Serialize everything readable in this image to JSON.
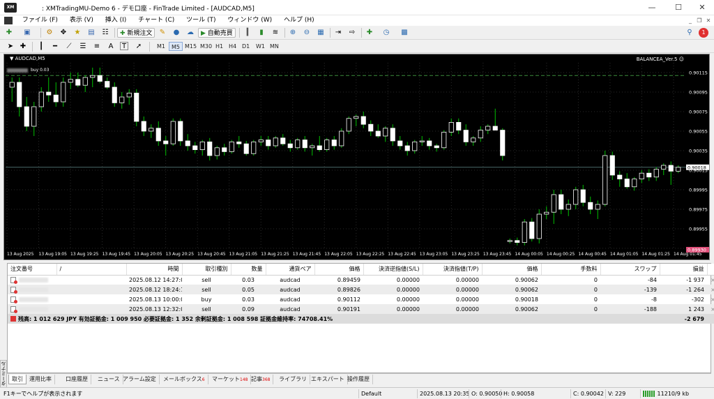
{
  "window": {
    "title": ": XMTradingMU-Demo 6 - デモ口座 - FinTrade Limited - [AUDCAD,M5]",
    "logo_text": "XM"
  },
  "menu": [
    "ファイル (F)",
    "表示 (V)",
    "挿入 (I)",
    "チャート (C)",
    "ツール (T)",
    "ウィンドウ (W)",
    "ヘルプ (H)"
  ],
  "toolbar": {
    "new_order_label": "新規注文",
    "autotrade_label": "自動売買",
    "notification_count": "1"
  },
  "tools": [
    "A",
    "T"
  ],
  "timeframes": [
    "M1",
    "M5",
    "M15",
    "M30",
    "H1",
    "H4",
    "D1",
    "W1",
    "MN"
  ],
  "active_timeframe": "M5",
  "chart": {
    "symbol_title": "AUDCAD,M5",
    "indicator": "BALANCEA_Ver.5",
    "order_line_label": "buy 0.03",
    "current_price": "0.90018",
    "bid_marker": "0.89930",
    "colors": {
      "background": "#000000",
      "bull_fill": "#000000",
      "bull_stroke": "#ffffff",
      "bear_fill": "#ffffff",
      "wick": "#00c000",
      "order_line": "#3c8c3c",
      "price_line": "#4a6a6a",
      "bid_marker": "#e0507a"
    }
  },
  "chart_data": {
    "type": "candlestick",
    "price_axis_labels": [
      "0.90115",
      "0.90095",
      "0.90075",
      "0.90055",
      "0.90035",
      "0.90015",
      "0.89995",
      "0.89975",
      "0.89955",
      "0.89935"
    ],
    "time_axis_labels": [
      "13 Aug 2025",
      "13 Aug 19:05",
      "13 Aug 19:25",
      "13 Aug 19:45",
      "13 Aug 20:05",
      "13 Aug 20:25",
      "13 Aug 20:45",
      "13 Aug 21:05",
      "13 Aug 21:25",
      "13 Aug 21:45",
      "13 Aug 22:05",
      "13 Aug 22:25",
      "13 Aug 22:45",
      "13 Aug 23:05",
      "13 Aug 23:25",
      "13 Aug 23:45",
      "14 Aug 00:05",
      "14 Aug 00:25",
      "14 Aug 00:45",
      "14 Aug 01:05",
      "14 Aug 01:25",
      "14 Aug 01:45"
    ],
    "ylim": [
      0.89935,
      0.90125
    ],
    "order_line_price": 0.90112,
    "current_price": 0.90018,
    "ohlc": [
      [
        0.901,
        0.9011,
        0.90085,
        0.90105
      ],
      [
        0.90105,
        0.9011,
        0.9007,
        0.9008
      ],
      [
        0.9008,
        0.9009,
        0.90055,
        0.9006
      ],
      [
        0.9006,
        0.90085,
        0.9005,
        0.9008
      ],
      [
        0.9008,
        0.901,
        0.90075,
        0.90095
      ],
      [
        0.90095,
        0.9011,
        0.90085,
        0.90092
      ],
      [
        0.90092,
        0.90105,
        0.9008,
        0.90085
      ],
      [
        0.90085,
        0.9011,
        0.9008,
        0.90105
      ],
      [
        0.90105,
        0.90115,
        0.90098,
        0.90108
      ],
      [
        0.90108,
        0.90115,
        0.901,
        0.90102
      ],
      [
        0.90102,
        0.90112,
        0.90095,
        0.9011
      ],
      [
        0.9011,
        0.9012,
        0.901,
        0.90112
      ],
      [
        0.90112,
        0.9012,
        0.90104,
        0.90106
      ],
      [
        0.90106,
        0.9011,
        0.90098,
        0.901
      ],
      [
        0.901,
        0.90105,
        0.9008,
        0.90084
      ],
      [
        0.90084,
        0.90095,
        0.90078,
        0.9009
      ],
      [
        0.9009,
        0.90098,
        0.90082,
        0.90094
      ],
      [
        0.90094,
        0.90098,
        0.9006,
        0.90065
      ],
      [
        0.90065,
        0.9007,
        0.9005,
        0.90055
      ],
      [
        0.90055,
        0.90062,
        0.90048,
        0.90058
      ],
      [
        0.90058,
        0.90065,
        0.9004,
        0.90045
      ],
      [
        0.90045,
        0.9005,
        0.9003,
        0.90042
      ],
      [
        0.90042,
        0.90068,
        0.9004,
        0.90065
      ],
      [
        0.90065,
        0.90068,
        0.9004,
        0.90045
      ],
      [
        0.90045,
        0.90052,
        0.90035,
        0.9004
      ],
      [
        0.9004,
        0.90044,
        0.90032,
        0.90036
      ],
      [
        0.90036,
        0.90046,
        0.9003,
        0.90044
      ],
      [
        0.90044,
        0.90048,
        0.90025,
        0.9003
      ],
      [
        0.9003,
        0.9004,
        0.90026,
        0.90038
      ],
      [
        0.90038,
        0.90042,
        0.9003,
        0.90034
      ],
      [
        0.90034,
        0.90046,
        0.90032,
        0.90044
      ],
      [
        0.90044,
        0.9005,
        0.90038,
        0.90042
      ],
      [
        0.90042,
        0.90045,
        0.9003,
        0.90032
      ],
      [
        0.90032,
        0.90046,
        0.9003,
        0.90044
      ],
      [
        0.90044,
        0.9005,
        0.9004,
        0.90046
      ],
      [
        0.90046,
        0.9005,
        0.90036,
        0.9004
      ],
      [
        0.9004,
        0.9005,
        0.90038,
        0.90048
      ],
      [
        0.90048,
        0.90052,
        0.9004,
        0.90042
      ],
      [
        0.90042,
        0.90046,
        0.90034,
        0.90038
      ],
      [
        0.90038,
        0.90048,
        0.90036,
        0.90046
      ],
      [
        0.90046,
        0.9005,
        0.90034,
        0.90038
      ],
      [
        0.90038,
        0.90042,
        0.9003,
        0.9004
      ],
      [
        0.9004,
        0.9005,
        0.90034,
        0.90036
      ],
      [
        0.90036,
        0.90048,
        0.90034,
        0.90046
      ],
      [
        0.90046,
        0.9005,
        0.90036,
        0.9004
      ],
      [
        0.9004,
        0.90058,
        0.90038,
        0.90055
      ],
      [
        0.90055,
        0.9007,
        0.90052,
        0.90068
      ],
      [
        0.90068,
        0.90072,
        0.9006,
        0.9007
      ],
      [
        0.9007,
        0.90075,
        0.90058,
        0.90062
      ],
      [
        0.90062,
        0.90066,
        0.9005,
        0.90055
      ],
      [
        0.90055,
        0.90062,
        0.90048,
        0.9005
      ],
      [
        0.9005,
        0.9006,
        0.90044,
        0.90058
      ],
      [
        0.90058,
        0.90062,
        0.9004,
        0.90045
      ],
      [
        0.90045,
        0.9005,
        0.90036,
        0.9004
      ],
      [
        0.9004,
        0.90044,
        0.9003,
        0.90035
      ],
      [
        0.90035,
        0.90046,
        0.90032,
        0.90044
      ],
      [
        0.90044,
        0.9005,
        0.9004,
        0.90045
      ],
      [
        0.90045,
        0.90048,
        0.90036,
        0.9004
      ],
      [
        0.9004,
        0.90042,
        0.90034,
        0.90038
      ],
      [
        0.90038,
        0.90056,
        0.90036,
        0.90054
      ],
      [
        0.90054,
        0.90068,
        0.9005,
        0.90064
      ],
      [
        0.90064,
        0.90068,
        0.90052,
        0.90056
      ],
      [
        0.90056,
        0.90062,
        0.9004,
        0.90044
      ],
      [
        0.90044,
        0.9005,
        0.9004,
        0.90048
      ],
      [
        0.90048,
        0.9006,
        0.90044,
        0.90056
      ],
      [
        0.90056,
        0.90062,
        0.90052,
        0.9006
      ],
      [
        0.9006,
        0.90078,
        0.90056,
        0.90056
      ],
      [
        0.90056,
        0.90058,
        0.90025,
        0.9003
      ],
      [
        0.89942,
        0.89945,
        0.8994,
        0.89943
      ],
      [
        0.89943,
        0.89946,
        0.89938,
        0.89941
      ],
      [
        0.89941,
        0.89965,
        0.89938,
        0.89962
      ],
      [
        0.89962,
        0.89966,
        0.89942,
        0.89945
      ],
      [
        0.89945,
        0.89975,
        0.8994,
        0.8997
      ],
      [
        0.8997,
        0.89978,
        0.89965,
        0.89972
      ],
      [
        0.89972,
        0.89995,
        0.8996,
        0.8999
      ],
      [
        0.8999,
        0.89995,
        0.8997,
        0.89975
      ],
      [
        0.89975,
        0.89985,
        0.89968,
        0.8998
      ],
      [
        0.8998,
        0.89998,
        0.89975,
        0.89995
      ],
      [
        0.89995,
        0.9,
        0.89978,
        0.89982
      ],
      [
        0.89982,
        0.89988,
        0.8997,
        0.89975
      ],
      [
        0.89975,
        0.89984,
        0.89965,
        0.8998
      ],
      [
        0.8998,
        0.90035,
        0.89978,
        0.9003
      ],
      [
        0.9003,
        0.90034,
        0.90005,
        0.9001
      ],
      [
        0.9001,
        0.90014,
        0.89998,
        0.90006
      ],
      [
        0.90006,
        0.90012,
        0.89996,
        0.89998
      ],
      [
        0.89998,
        0.90008,
        0.89994,
        0.90006
      ],
      [
        0.90006,
        0.90015,
        0.90002,
        0.90012
      ],
      [
        0.90012,
        0.90016,
        0.90004,
        0.90008
      ],
      [
        0.90008,
        0.90018,
        0.90004,
        0.90016
      ],
      [
        0.90016,
        0.90022,
        0.9001,
        0.9002
      ],
      [
        0.9002,
        0.90024,
        0.9,
        0.90014
      ],
      [
        0.90014,
        0.9002,
        0.90012,
        0.90018
      ]
    ]
  },
  "terminal": {
    "columns": [
      "注文番号",
      "/",
      "時間",
      "取引種別",
      "数量",
      "通貨ペア",
      "価格",
      "決済逆指値(S/L)",
      "決済指値(T/P)",
      "価格",
      "手数料",
      "スワップ",
      "損益"
    ],
    "rows": [
      {
        "time": "2025.08.12 14:27:00",
        "type": "sell",
        "volume": "0.03",
        "symbol": "audcad",
        "price": "0.89459",
        "sl": "0.00000",
        "tp": "0.00000",
        "current": "0.90062",
        "commission": "0",
        "swap": "-84",
        "profit": "-1 937"
      },
      {
        "time": "2025.08.12 18:24:18",
        "type": "sell",
        "volume": "0.05",
        "symbol": "audcad",
        "price": "0.89826",
        "sl": "0.00000",
        "tp": "0.00000",
        "current": "0.90062",
        "commission": "0",
        "swap": "-139",
        "profit": "-1 264"
      },
      {
        "time": "2025.08.13 10:00:00",
        "type": "buy",
        "volume": "0.03",
        "symbol": "audcad",
        "price": "0.90112",
        "sl": "0.00000",
        "tp": "0.00000",
        "current": "0.90018",
        "commission": "0",
        "swap": "-8",
        "profit": "-302"
      },
      {
        "time": "2025.08.13 12:32:01",
        "type": "sell",
        "volume": "0.09",
        "symbol": "audcad",
        "price": "0.90191",
        "sl": "0.00000",
        "tp": "0.00000",
        "current": "0.90062",
        "commission": "0",
        "swap": "-188",
        "profit": "1 243"
      }
    ],
    "summary_text": "残高: 1 012 629 JPY  有効証拠金: 1 009 950  必要証拠金: 1 352  余剰証拠金: 1 008 598  証拠金維持率: 74708.41%",
    "summary_profit": "-2 679",
    "close_glyph": "×"
  },
  "side_label": "ターミナル",
  "tabs": [
    {
      "label": "取引",
      "badge": ""
    },
    {
      "label": "運用比率",
      "badge": ""
    },
    {
      "label": "口座履歴",
      "badge": ""
    },
    {
      "label": "ニュース",
      "badge": ""
    },
    {
      "label": "アラーム設定",
      "badge": ""
    },
    {
      "label": "メールボックス",
      "badge": "6"
    },
    {
      "label": "マーケット",
      "badge": "148"
    },
    {
      "label": "記事",
      "badge": "368"
    },
    {
      "label": "ライブラリ",
      "badge": ""
    },
    {
      "label": "エキスパート",
      "badge": ""
    },
    {
      "label": "操作履歴",
      "badge": ""
    }
  ],
  "statusbar": {
    "help": "F1キーでヘルプが表示されます",
    "profile": "Default",
    "datetime": "2025.08.13 20:35",
    "open": "O: 0.90050",
    "high": "H: 0.90058",
    "close": "C: 0.90042",
    "volume": "V: 229",
    "traffic": "11210/9 kb"
  }
}
